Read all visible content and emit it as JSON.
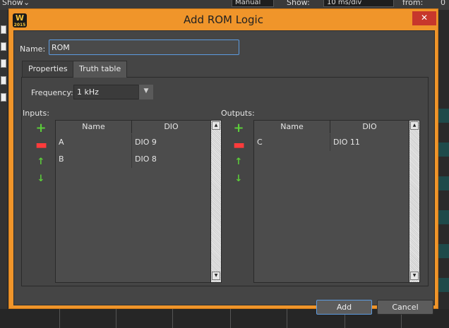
{
  "background": {
    "show_label": "Show",
    "mode_value": "Manual",
    "show2_label": "Show:",
    "timebase_value": "10 ms/div",
    "from_label": "from:",
    "from_value": "0"
  },
  "dialog": {
    "title": "Add ROM Logic",
    "app_logo": "W",
    "app_logo_sub": "2015",
    "close_glyph": "✕",
    "name_label": "Name:",
    "name_value": "ROM",
    "tabs": [
      {
        "label": "Properties",
        "selected": false
      },
      {
        "label": "Truth table",
        "selected": true
      }
    ],
    "frequency_label": "Frequency:",
    "frequency_value": "1 kHz",
    "inputs": {
      "label": "Inputs:",
      "columns": [
        "Name",
        "DIO"
      ],
      "rows": [
        {
          "name": "A",
          "dio": "DIO 9"
        },
        {
          "name": "B",
          "dio": "DIO 8"
        }
      ]
    },
    "outputs": {
      "label": "Outputs:",
      "columns": [
        "Name",
        "DIO"
      ],
      "rows": [
        {
          "name": "C",
          "dio": "DIO 11"
        }
      ]
    },
    "tools": {
      "add": "+",
      "remove": "▬",
      "up": "↑",
      "down": "↓"
    },
    "buttons": {
      "add": "Add",
      "cancel": "Cancel"
    }
  },
  "colors": {
    "dialog_frame": "#f0952a",
    "client_bg": "#454545",
    "add_icon": "#5ccd3a",
    "remove_icon": "#ff3b3b",
    "focus_border": "#5d9be0"
  }
}
